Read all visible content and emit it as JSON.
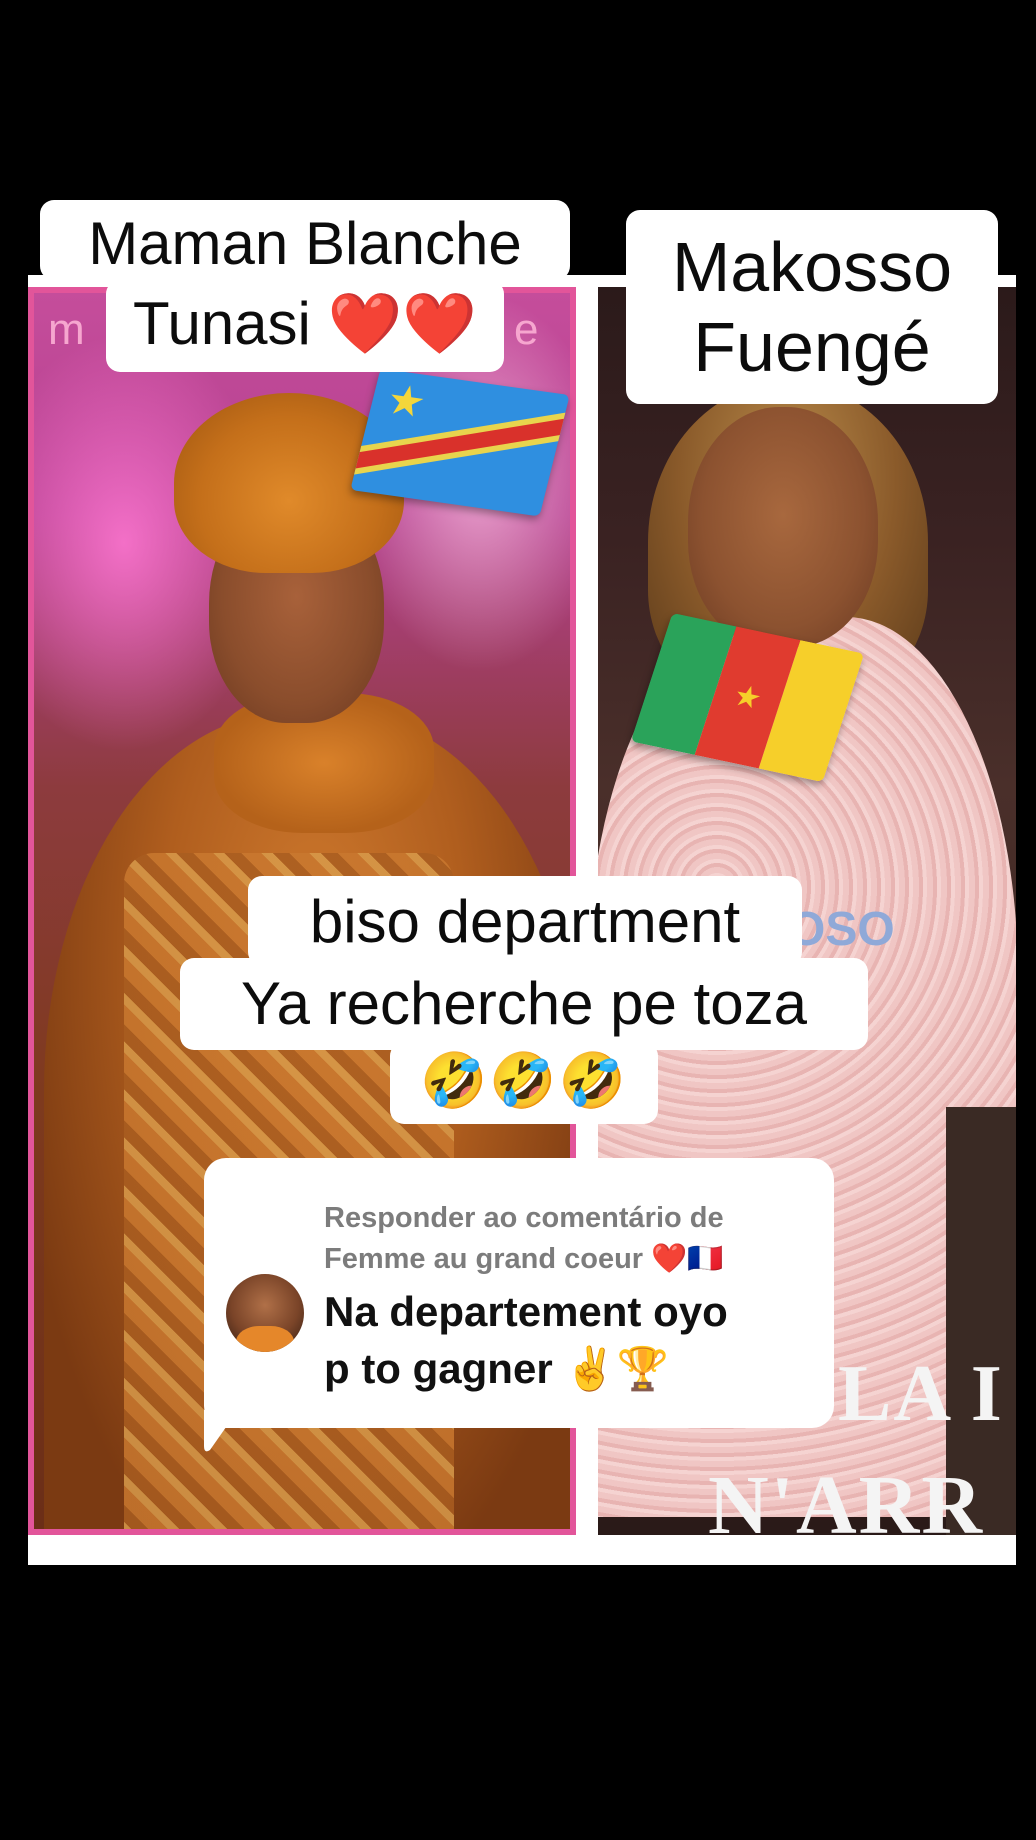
{
  "labels": {
    "left_name_line1": "Maman Blanche",
    "left_name_line2": "Tunasi ❤️❤️",
    "right_name": "Makosso Fuengé"
  },
  "caption": {
    "line1": "biso department",
    "line2": "Ya recherche pe toza",
    "line3": "🤣🤣🤣"
  },
  "background_text": {
    "left_corner_1": "m",
    "left_corner_2": "e",
    "right_watermark": "OSO",
    "right_bottom_1": "LA I",
    "right_bottom_2": "N'ARR"
  },
  "reply": {
    "header_line1": "Responder ao comentário de",
    "header_line2": "Femme au grand coeur ❤️🇫🇷",
    "body_line1": "Na departement oyo",
    "body_line2": "p to gagner ✌️🏆"
  },
  "icons": {
    "flag_left": "drc-flag-icon",
    "flag_right": "cameroon-flag-icon",
    "avatar": "user-avatar"
  },
  "colors": {
    "background": "#000000",
    "label_bg": "#ffffff",
    "label_text": "#0c0c0c",
    "reply_header": "#7c7c7c",
    "left_border": "#e2559a"
  }
}
